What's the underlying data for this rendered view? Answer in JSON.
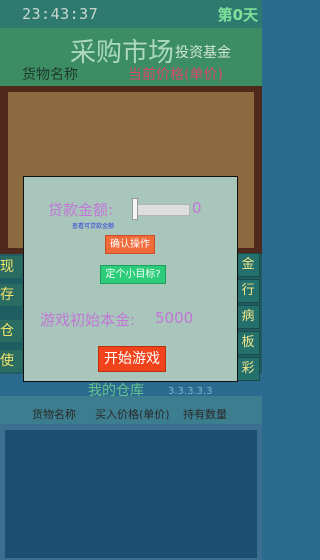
{
  "status": {
    "time": "23:43:37",
    "day": "第0天"
  },
  "header": {
    "title": "采购市场",
    "fund_label": "投资基金"
  },
  "market": {
    "col_goods": "货物名称",
    "col_price": "当前价格(单价)"
  },
  "side_left": [
    "现",
    "存",
    "仓",
    "使"
  ],
  "side_right": [
    "金",
    "行",
    "病",
    "板",
    "彩"
  ],
  "warehouse": {
    "title": "我的仓库",
    "capacity": "3.3.3.3.3",
    "col_goods": "货物名称",
    "col_buy_price": "买入价格(单价)",
    "col_quantity": "持有数量"
  },
  "dialog": {
    "loan_label": "贷款金额:",
    "loan_value": "0",
    "slider_fraction": 0,
    "hint": "查看可贷款金额",
    "confirm_button": "确认操作",
    "target_button": "定个小目标?",
    "capital_label": "游戏初始本金:",
    "capital_value": "5000",
    "start_button": "开始游戏"
  },
  "colors": {
    "dialog_bg": "#a8c6bc",
    "purple_text": "#c277d6",
    "confirm": "#f06a3a",
    "target": "#2dcc7a",
    "start": "#f0431c"
  }
}
